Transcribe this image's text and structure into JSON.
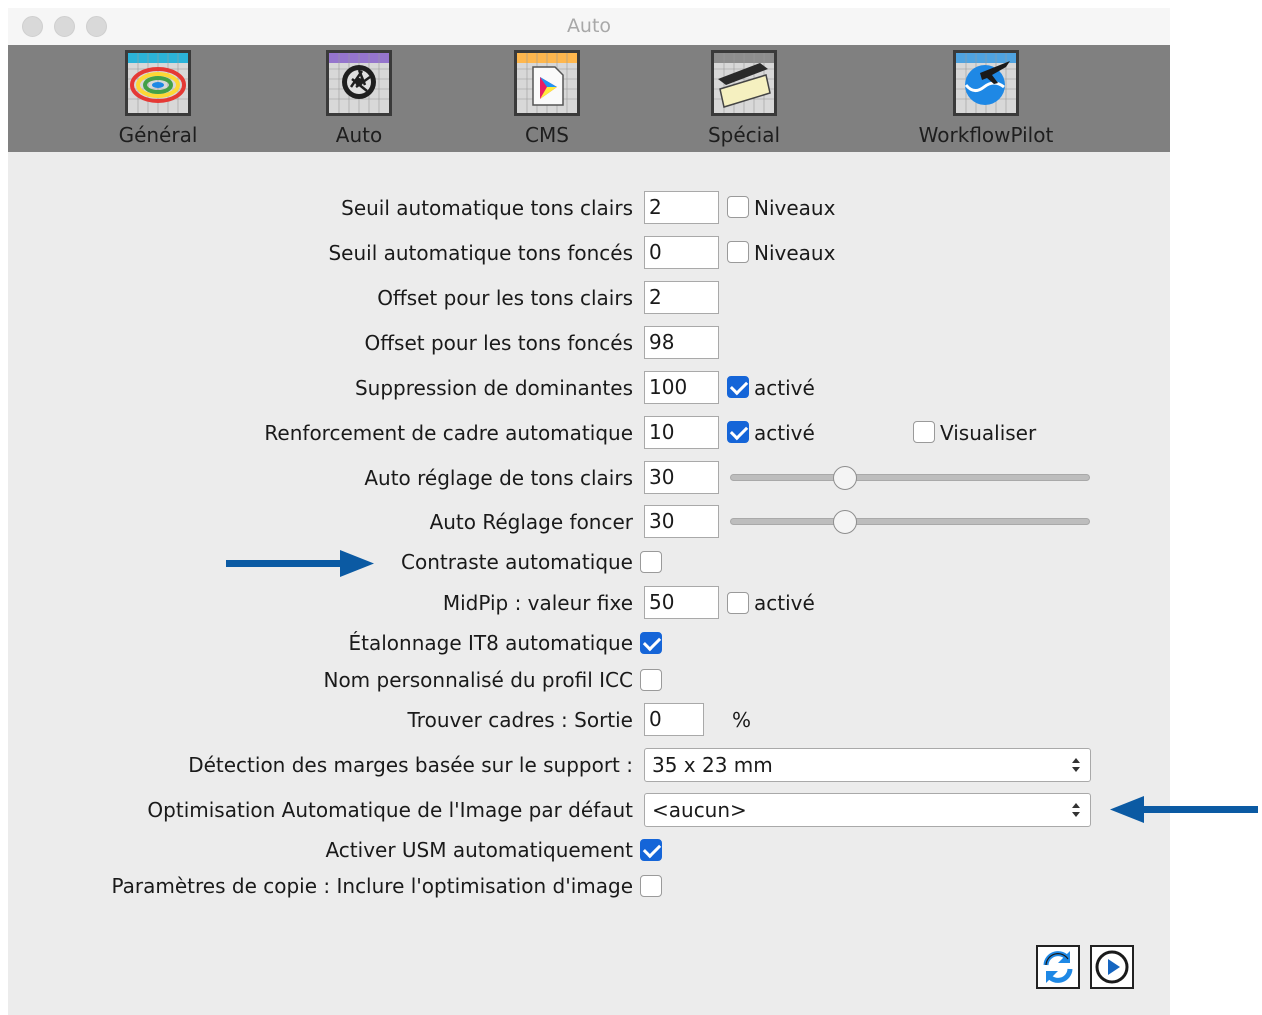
{
  "window": {
    "title": "Auto"
  },
  "toolbar": {
    "items": [
      {
        "label": "Général",
        "icon": "general-settings-icon"
      },
      {
        "label": "Auto",
        "icon": "aperture-icon"
      },
      {
        "label": "CMS",
        "icon": "color-profile-icon"
      },
      {
        "label": "Spécial",
        "icon": "scanner-icon"
      },
      {
        "label": "WorkflowPilot",
        "icon": "workflow-pilot-icon"
      }
    ]
  },
  "settings": {
    "seuil_clairs": {
      "label": "Seuil automatique tons clairs",
      "value": "2",
      "check_label": "Niveaux",
      "checked": false
    },
    "seuil_fonces": {
      "label": "Seuil automatique tons foncés",
      "value": "0",
      "check_label": "Niveaux",
      "checked": false
    },
    "offset_clairs": {
      "label": "Offset pour les tons clairs",
      "value": "2"
    },
    "offset_fonces": {
      "label": "Offset pour les tons foncés",
      "value": "98"
    },
    "suppression": {
      "label": "Suppression de dominantes",
      "value": "100",
      "check_label": "activé",
      "checked": true
    },
    "renforcement": {
      "label": "Renforcement de cadre automatique",
      "value": "10",
      "check_label": "activé",
      "checked": true,
      "visualiser_label": "Visualiser",
      "visualiser_checked": false
    },
    "auto_clairs": {
      "label": "Auto réglage de tons clairs",
      "value": "30",
      "slider_fraction": 0.32
    },
    "auto_foncer": {
      "label": "Auto Réglage foncer",
      "value": "30",
      "slider_fraction": 0.32
    },
    "contraste": {
      "label": "Contraste automatique",
      "checked": false
    },
    "midpip": {
      "label": "MidPip : valeur fixe",
      "value": "50",
      "check_label": "activé",
      "checked": false
    },
    "it8": {
      "label": "Étalonnage IT8 automatique",
      "checked": true
    },
    "icc": {
      "label": "Nom personnalisé du profil ICC",
      "checked": false
    },
    "cadres": {
      "label": "Trouver cadres : Sortie",
      "value": "0",
      "unit": "%"
    },
    "marges": {
      "label": "Détection des marges basée sur le support :",
      "selected": "35 x 23 mm"
    },
    "optimisation": {
      "label": "Optimisation Automatique de l'Image par défaut",
      "selected": "<aucun>"
    },
    "usm": {
      "label": "Activer USM automatiquement",
      "checked": true
    },
    "copie": {
      "label": "Paramètres de copie : Inclure l'optimisation d'image",
      "checked": false
    }
  },
  "footer": {
    "refresh_icon": "refresh-icon",
    "play_icon": "play-icon"
  },
  "colors": {
    "toolbar": "#808080",
    "accent": "#1565d8",
    "annotation_arrow": "#0b5aa3"
  }
}
